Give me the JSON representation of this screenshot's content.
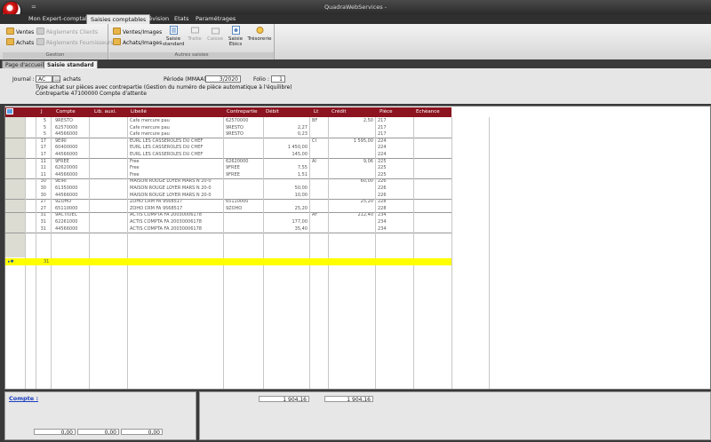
{
  "window": {
    "title": "QuadraWebServices -",
    "quick_access": "="
  },
  "menu_tabs": [
    "Mon Expert-comptable",
    "Saisies comptables",
    "Révision",
    "Etats",
    "Paramétrages"
  ],
  "ribbon": {
    "groups": {
      "gestion": "Gestion",
      "autres_saisies": "Autres saisies"
    },
    "ventes": "Ventes",
    "achats": "Achats",
    "reglements_clients": "Règlements Clients",
    "reglements_fournisseurs": "Règlements Fournisseurs",
    "ventes_images": "Ventes/Images",
    "achats_images": "Achats/Images",
    "saisie_standard": "Saisie standard",
    "traite": "Traite",
    "caisse": "Caisse",
    "saisie_ebics": "Saisie Ebics",
    "tresorerie": "Trésorerie"
  },
  "doc_tabs": [
    "Page d'accueil",
    "Saisie standard"
  ],
  "form": {
    "journal_label": "Journal :",
    "journal_code": "AC",
    "journal_btn": "...",
    "journal_name": "achats",
    "periode_label": "Période (MMAA) :",
    "periode_value": "3/2020",
    "folio_label": "Folio :",
    "folio_value": "1",
    "info1": "Type achat sur pièces avec contrepartie (Gestion du numéro de pièce automatique à l'équilibre)",
    "info2": "Contrepartie 47100000 Compte d'attente"
  },
  "grid": {
    "headers": [
      "J",
      "Compte",
      "Lib. auxi.",
      "Libellé",
      "Contrepartie",
      "Débit",
      "Lt",
      "Crédit",
      "Pièce",
      "Echéance"
    ],
    "rows": [
      [
        "5",
        "9RESTO",
        "",
        "Cafe mercure pau",
        "62570000",
        "",
        "BF",
        "2,50",
        "217"
      ],
      [
        "5",
        "62570000",
        "",
        "Cafe mercure pau",
        "9RESTO",
        "2,27",
        "",
        "",
        "217"
      ],
      [
        "5",
        "44566000",
        "",
        "Cafe mercure pau",
        "9RESTO",
        "0,23",
        "",
        "",
        "217"
      ],
      [
        "17",
        "9EIRI",
        "",
        "EURL LES CASSEROLES DU CHEF",
        "",
        "",
        "CI",
        "1 595,00",
        "224"
      ],
      [
        "17",
        "60400000",
        "",
        "EURL LES CASSEROLES DU CHEF",
        "",
        "1 450,00",
        "",
        "",
        "224"
      ],
      [
        "17",
        "44566000",
        "",
        "EURL LES CASSEROLES DU CHEF",
        "",
        "145,00",
        "",
        "",
        "224"
      ],
      [
        "11",
        "9FREE",
        "",
        "Free",
        "62620000",
        "",
        "AI",
        "9,06",
        "225"
      ],
      [
        "11",
        "62620000",
        "",
        "Free",
        "9FREE",
        "7,55",
        "",
        "",
        "225"
      ],
      [
        "11",
        "44566000",
        "",
        "Free",
        "9FREE",
        "1,51",
        "",
        "",
        "225"
      ],
      [
        "30",
        "9EIRI",
        "",
        "MAISON ROUGE LOYER MARS N 20-0",
        "",
        "",
        "",
        "60,00",
        "226"
      ],
      [
        "30",
        "61350000",
        "",
        "MAISON ROUGE LOYER MARS N 20-0",
        "",
        "50,00",
        "",
        "",
        "226"
      ],
      [
        "30",
        "44566000",
        "",
        "MAISON ROUGE LOYER MARS N 20-0",
        "",
        "10,00",
        "",
        "",
        "226"
      ],
      [
        "27",
        "9ZOHO",
        "",
        "ZOHO CRM FA 9568517",
        "65110000",
        "",
        "",
        "25,20",
        "228"
      ],
      [
        "27",
        "65110000",
        "",
        "ZOHO CRM FA 9568517",
        "9ZOHO",
        "25,20",
        "",
        "",
        "228"
      ],
      [
        "31",
        "9ACTIOEC",
        "",
        "ACTIS COMPTA FA 20030006178",
        "",
        "",
        "AF",
        "212,40",
        "234"
      ],
      [
        "31",
        "62261000",
        "",
        "ACTIS COMPTA FA 20030006178",
        "",
        "177,00",
        "",
        "",
        "234"
      ],
      [
        "31",
        "44566000",
        "",
        "ACTIS COMPTA FA 20030006178",
        "",
        "35,40",
        "",
        "",
        "234"
      ]
    ],
    "new_row_day": "31",
    "new_row_marker": "▸✱"
  },
  "footer": {
    "compte_label": "Compte :",
    "totals_left": [
      "0,00",
      "0,00",
      "0,00"
    ],
    "total_debit": "1 904,16",
    "total_credit": "1 904,16"
  }
}
